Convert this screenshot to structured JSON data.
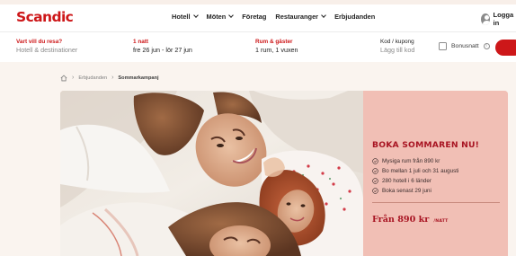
{
  "brand": {
    "logo_text": "Scandic",
    "color": "#cd1719"
  },
  "nav": {
    "items": [
      {
        "label": "Hotell",
        "has_dropdown": true
      },
      {
        "label": "Möten",
        "has_dropdown": true
      },
      {
        "label": "Företag",
        "has_dropdown": false
      },
      {
        "label": "Restauranger",
        "has_dropdown": true
      },
      {
        "label": "Erbjudanden",
        "has_dropdown": false
      }
    ],
    "login_label": "Logga in",
    "login_icon": "user-avatar-icon"
  },
  "booking": {
    "destination": {
      "label": "Vart vill du resa?",
      "placeholder": "Hotell & destinationer"
    },
    "dates": {
      "label": "1 natt",
      "value": "fre 26 jun - lör 27 jun"
    },
    "rooms": {
      "label": "Rum & gäster",
      "value": "1 rum, 1 vuxen"
    },
    "code": {
      "label": "Kod / kupong",
      "placeholder": "Lägg till kod"
    },
    "bonus": {
      "label": "Bonusnatt",
      "checked": false,
      "icon": "info-icon"
    },
    "search_button_color": "#cd1719"
  },
  "breadcrumb": {
    "home_icon": "home-icon",
    "items": [
      "Erbjudanden",
      "Sommarkampanj"
    ]
  },
  "promo": {
    "title": "BOKA SOMMAREN NU!",
    "features": [
      "Mysiga rum från 890 kr",
      "Bo mellan 1 juli och 31 augusti",
      "280 hotell i 6 länder",
      "Boka senast 29 juni"
    ],
    "feature_icon": "check-circle-icon",
    "price_main": "Från 890 kr",
    "price_unit": "/NATT",
    "panel_color": "#f1bfb5",
    "accent_color": "#a81422"
  }
}
